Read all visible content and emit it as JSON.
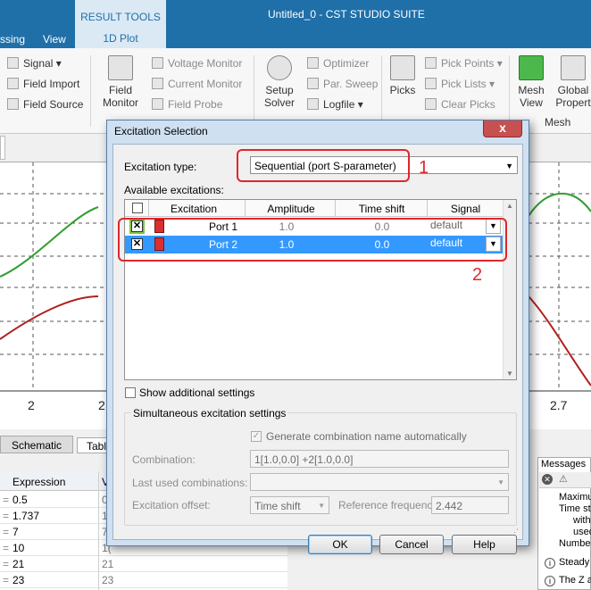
{
  "window": {
    "title": "Untitled_0 - CST STUDIO SUITE",
    "context_tab_group": "RESULT TOOLS",
    "context_tab": "1D Plot",
    "menu_tabs": [
      "ssing",
      "View"
    ]
  },
  "ribbon": {
    "col1": [
      "Signal",
      "Field Import",
      "Field Source"
    ],
    "field_monitor": "Field Monitor",
    "col2": [
      "Voltage Monitor",
      "Current Monitor",
      "Field Probe"
    ],
    "setup_solver": "Setup Solver",
    "col3": [
      "Optimizer",
      "Par. Sweep",
      "Logfile"
    ],
    "picks": "Picks",
    "col4": [
      "Pick Points",
      "Pick Lists",
      "Clear Picks"
    ],
    "mesh_view": "Mesh View",
    "global_props": "Global Propert",
    "mesh_group": "Mesh"
  },
  "plot": {
    "x_ticks": [
      "2",
      "2",
      "2.7"
    ]
  },
  "bottom": {
    "tabs": [
      "Schematic",
      "Tabl"
    ],
    "param_headers": [
      "Expression",
      "V"
    ],
    "params": [
      {
        "expr": "0.5",
        "val": "0"
      },
      {
        "expr": "1.737",
        "val": "1"
      },
      {
        "expr": "7",
        "val": "7"
      },
      {
        "expr": "10",
        "val": "1("
      },
      {
        "expr": "21",
        "val": "21"
      },
      {
        "expr": "23",
        "val": "23"
      }
    ],
    "messages_title": "Messages",
    "messages_lines": [
      "Maximu",
      "Time st",
      "with",
      "used",
      "Number",
      "Steady",
      "The Z a"
    ]
  },
  "dialog": {
    "title": "Excitation Selection",
    "close": "x",
    "excitation_type_label": "Excitation type:",
    "excitation_type_value": "Sequential (port S-parameter)",
    "available_label": "Available excitations:",
    "table": {
      "headers": [
        "Excitation",
        "Amplitude",
        "Time shift",
        "Signal"
      ],
      "rows": [
        {
          "name": "Port 1",
          "amplitude": "1.0",
          "time_shift": "0.0",
          "signal": "default",
          "checked": true
        },
        {
          "name": "Port 2",
          "amplitude": "1.0",
          "time_shift": "0.0",
          "signal": "default",
          "checked": true
        }
      ]
    },
    "show_additional": "Show additional settings",
    "simultaneous_title": "Simultaneous excitation settings",
    "generate_name": "Generate combination name automatically",
    "combination_label": "Combination:",
    "combination_value": "1[1.0,0.0] +2[1.0,0.0]",
    "last_used_label": "Last used combinations:",
    "offset_label": "Excitation offset:",
    "offset_value": "Time shift",
    "ref_freq_label": "Reference frequency:",
    "ref_freq_value": "2.442",
    "ok": "OK",
    "cancel": "Cancel",
    "help": "Help"
  },
  "annotations": {
    "one": "1",
    "two": "2",
    "color": "#e0262c"
  },
  "colors": {
    "title_bar": "#1f6fa8",
    "selection": "#3399ff",
    "curve_green": "#2e9e2e",
    "curve_red": "#b02020"
  }
}
